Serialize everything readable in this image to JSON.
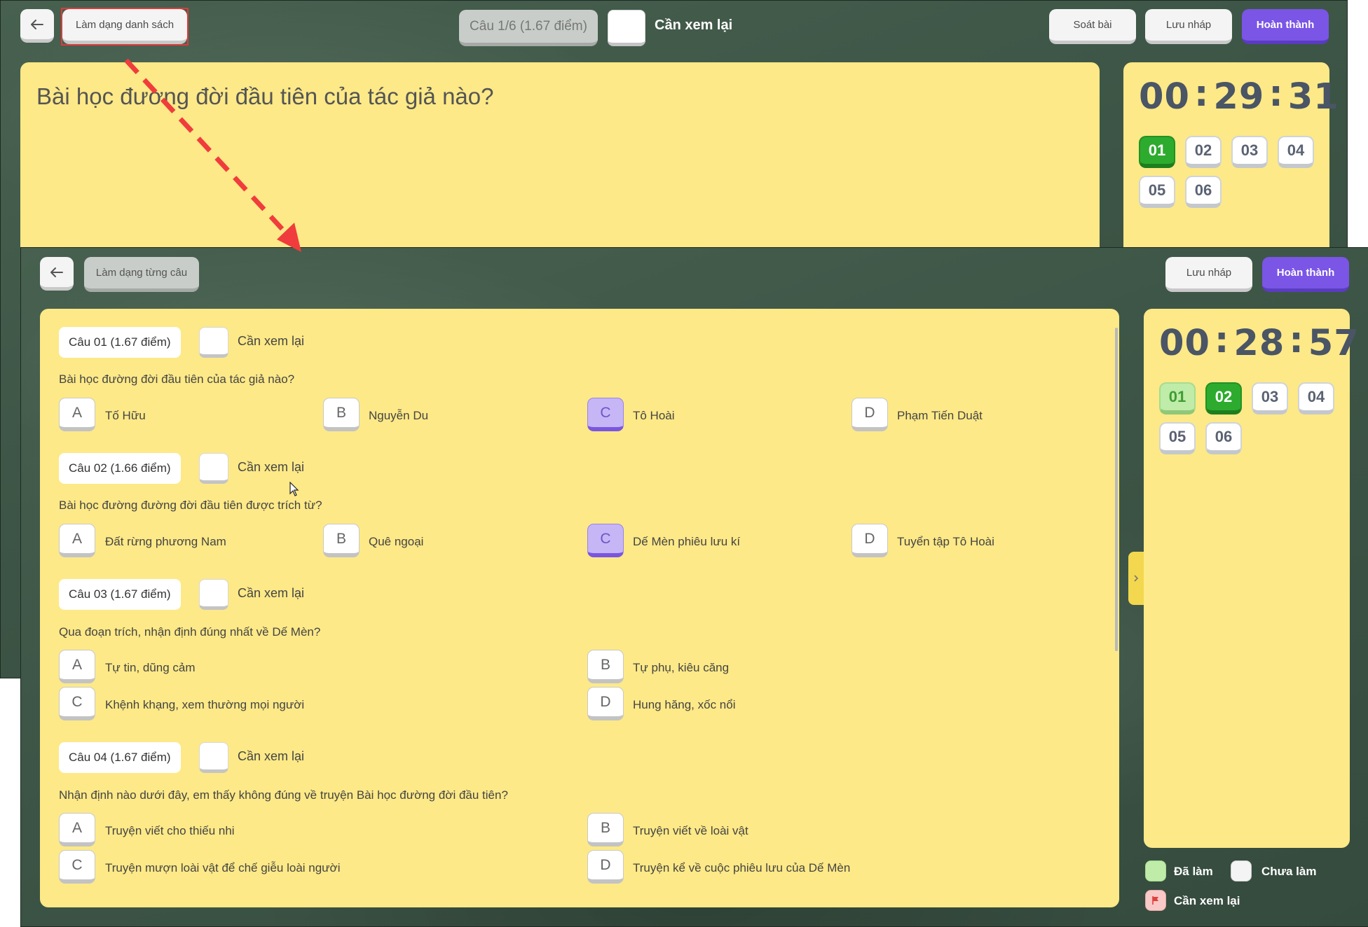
{
  "back_view": {
    "list_mode_button": "Làm dạng danh sách",
    "question_badge": "Câu 1/6 (1.67 điểm)",
    "review_label": "Cần xem lại",
    "check_button": "Soát bài",
    "draft_button": "Lưu nháp",
    "finish_button": "Hoàn thành",
    "question_text": "Bài học đường đời đầu tiên của tác giả nào?",
    "timer": {
      "hh": "00",
      "mm": "29",
      "ss": "31",
      "sep": ":"
    },
    "question_nums": [
      "01",
      "02",
      "03",
      "04",
      "05",
      "06"
    ],
    "current_question": "01"
  },
  "front_view": {
    "single_mode_button": "Làm dạng từng câu",
    "draft_button": "Lưu nháp",
    "finish_button": "Hoàn thành",
    "timer": {
      "hh": "00",
      "mm": "28",
      "ss": "57",
      "sep": ":"
    },
    "question_nums": [
      "01",
      "02",
      "03",
      "04",
      "05",
      "06"
    ],
    "current_question": "02",
    "done_questions": [
      "01"
    ],
    "legend": {
      "done": "Đã làm",
      "not_done": "Chưa làm",
      "review": "Cần xem lại"
    },
    "review_label": "Cần xem lại",
    "questions": [
      {
        "label": "Câu 01 (1.67 điểm)",
        "text": "Bài học đường đời đầu tiên của tác giả nào?",
        "layout": "row",
        "selected": "C",
        "options": [
          {
            "letter": "A",
            "text": "Tố Hữu"
          },
          {
            "letter": "B",
            "text": "Nguyễn Du"
          },
          {
            "letter": "C",
            "text": "Tô Hoài"
          },
          {
            "letter": "D",
            "text": "Phạm Tiến Duật"
          }
        ]
      },
      {
        "label": "Câu 02 (1.66 điểm)",
        "text": "Bài học đường đường đời đầu tiên được trích từ?",
        "layout": "row",
        "selected": "C",
        "options": [
          {
            "letter": "A",
            "text": "Đất rừng phương Nam"
          },
          {
            "letter": "B",
            "text": "Quê ngoại"
          },
          {
            "letter": "C",
            "text": "Dế Mèn phiêu lưu kí"
          },
          {
            "letter": "D",
            "text": "Tuyển tập Tô Hoài"
          }
        ]
      },
      {
        "label": "Câu 03 (1.67 điểm)",
        "text": "Qua đoạn trích, nhận định đúng nhất về Dế Mèn?",
        "layout": "grid",
        "selected": null,
        "options": [
          {
            "letter": "A",
            "text": "Tự tin, dũng cảm"
          },
          {
            "letter": "B",
            "text": "Tự phụ, kiêu căng"
          },
          {
            "letter": "C",
            "text": "Khệnh khạng, xem thường mọi người"
          },
          {
            "letter": "D",
            "text": "Hung hăng, xốc nổi"
          }
        ]
      },
      {
        "label": "Câu 04 (1.67 điểm)",
        "text": "Nhận định nào dưới đây, em thấy không đúng về truyện Bài học đường đời đầu tiên?",
        "layout": "grid",
        "selected": null,
        "options": [
          {
            "letter": "A",
            "text": "Truyện viết cho thiếu nhi"
          },
          {
            "letter": "B",
            "text": "Truyện viết về loài vật"
          },
          {
            "letter": "C",
            "text": "Truyện mượn loài vật để chế giễu loài người"
          },
          {
            "letter": "D",
            "text": "Truyện kể về cuộc phiêu lưu của Dế Mèn"
          }
        ]
      }
    ]
  },
  "colors": {
    "accent_purple": "#7a55e6",
    "done_green": "#2dab2e",
    "panel_yellow": "#fde987",
    "annotation_red": "#f03c3c"
  }
}
